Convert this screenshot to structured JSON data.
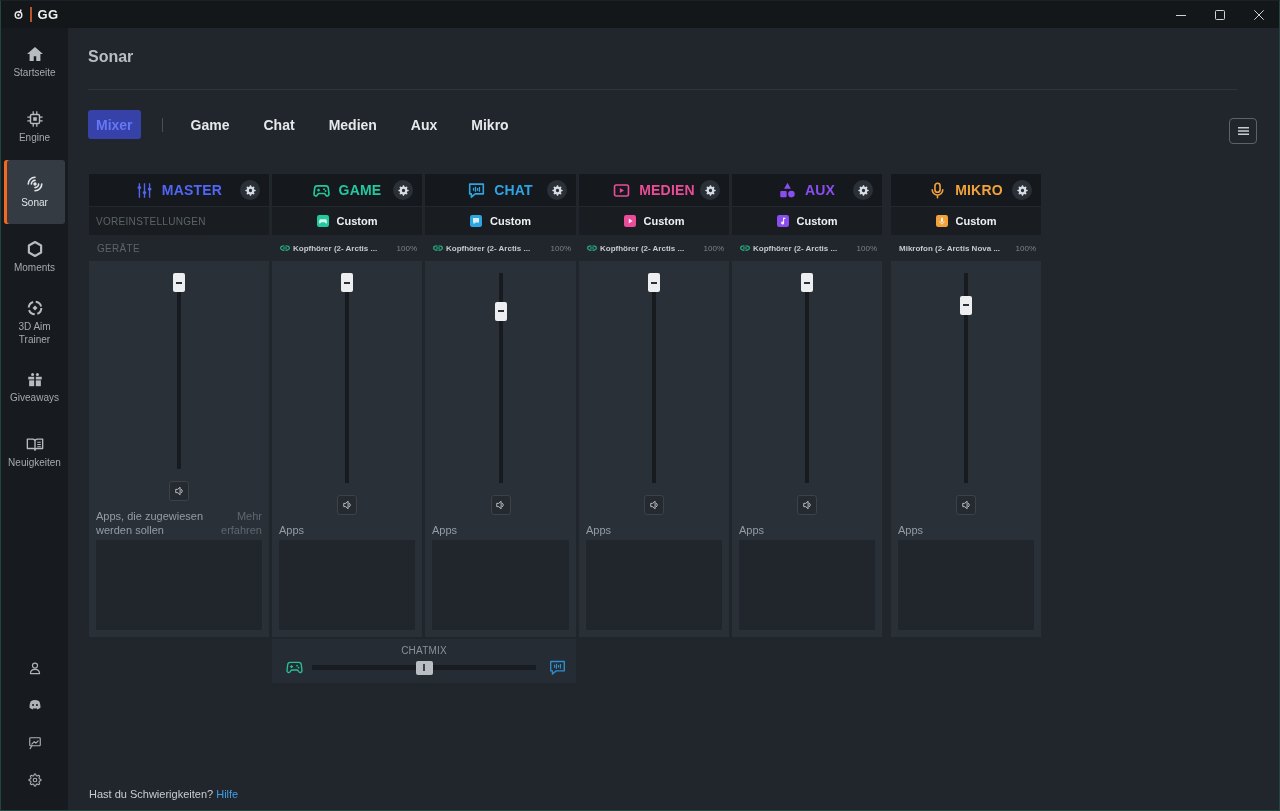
{
  "window": {
    "logo_text": "GG"
  },
  "sidebar": {
    "items": [
      {
        "label": "Startseite",
        "selected": false
      },
      {
        "label": "Engine",
        "selected": false
      },
      {
        "label": "Sonar",
        "selected": true
      },
      {
        "label": "Moments",
        "selected": false
      },
      {
        "label": "3D Aim Trainer",
        "selected": false
      },
      {
        "label": "Giveaways",
        "selected": false
      },
      {
        "label": "Neuigkeiten",
        "selected": false
      }
    ]
  },
  "page": {
    "title": "Sonar"
  },
  "tabs": [
    {
      "label": "Mixer",
      "selected": true
    },
    {
      "label": "Game",
      "selected": false
    },
    {
      "label": "Chat",
      "selected": false
    },
    {
      "label": "Medien",
      "selected": false
    },
    {
      "label": "Aux",
      "selected": false
    },
    {
      "label": "Mikro",
      "selected": false
    }
  ],
  "channels": [
    {
      "kind": "master",
      "name": "MASTER",
      "color": "#5266f5",
      "preset": "VOREINSTELLUNGEN",
      "device": "GERÄTE",
      "level": 1,
      "apps_label": "Apps, die zugewiesen werden sollen",
      "more_link": "Mehr erfahren"
    },
    {
      "kind": "game",
      "name": "GAME",
      "color": "#24c89f",
      "preset": "Custom",
      "device": "Kopfhörer (2- Arctis ...",
      "device_level": "100%",
      "linked": true,
      "level": 1,
      "apps_label": "Apps"
    },
    {
      "kind": "chat",
      "name": "CHAT",
      "color": "#2ea4e2",
      "preset": "Custom",
      "device": "Kopfhörer (2- Arctis ...",
      "device_level": "100%",
      "linked": true,
      "level": 0.85,
      "apps_label": "Apps"
    },
    {
      "kind": "media",
      "name": "MEDIEN",
      "color": "#ea4c98",
      "preset": "Custom",
      "device": "Kopfhörer (2- Arctis ...",
      "device_level": "100%",
      "linked": true,
      "level": 1,
      "apps_label": "Apps"
    },
    {
      "kind": "aux",
      "name": "AUX",
      "color": "#8a4ef0",
      "preset": "Custom",
      "device": "Kopfhörer (2- Arctis ...",
      "device_level": "100%",
      "linked": true,
      "level": 1,
      "apps_label": "Apps"
    },
    {
      "kind": "mic",
      "name": "MIKRO",
      "color": "#f2a23a",
      "preset": "Custom",
      "device": "Mikrofon (2- Arctis Nova ...",
      "device_level": "100%",
      "linked": false,
      "level": 0.88,
      "apps_label": "Apps"
    }
  ],
  "chatmix": {
    "label": "CHATMIX",
    "level": 0.5
  },
  "footer": {
    "text": "Hast du Schwierigkeiten?",
    "link": "Hilfe"
  }
}
